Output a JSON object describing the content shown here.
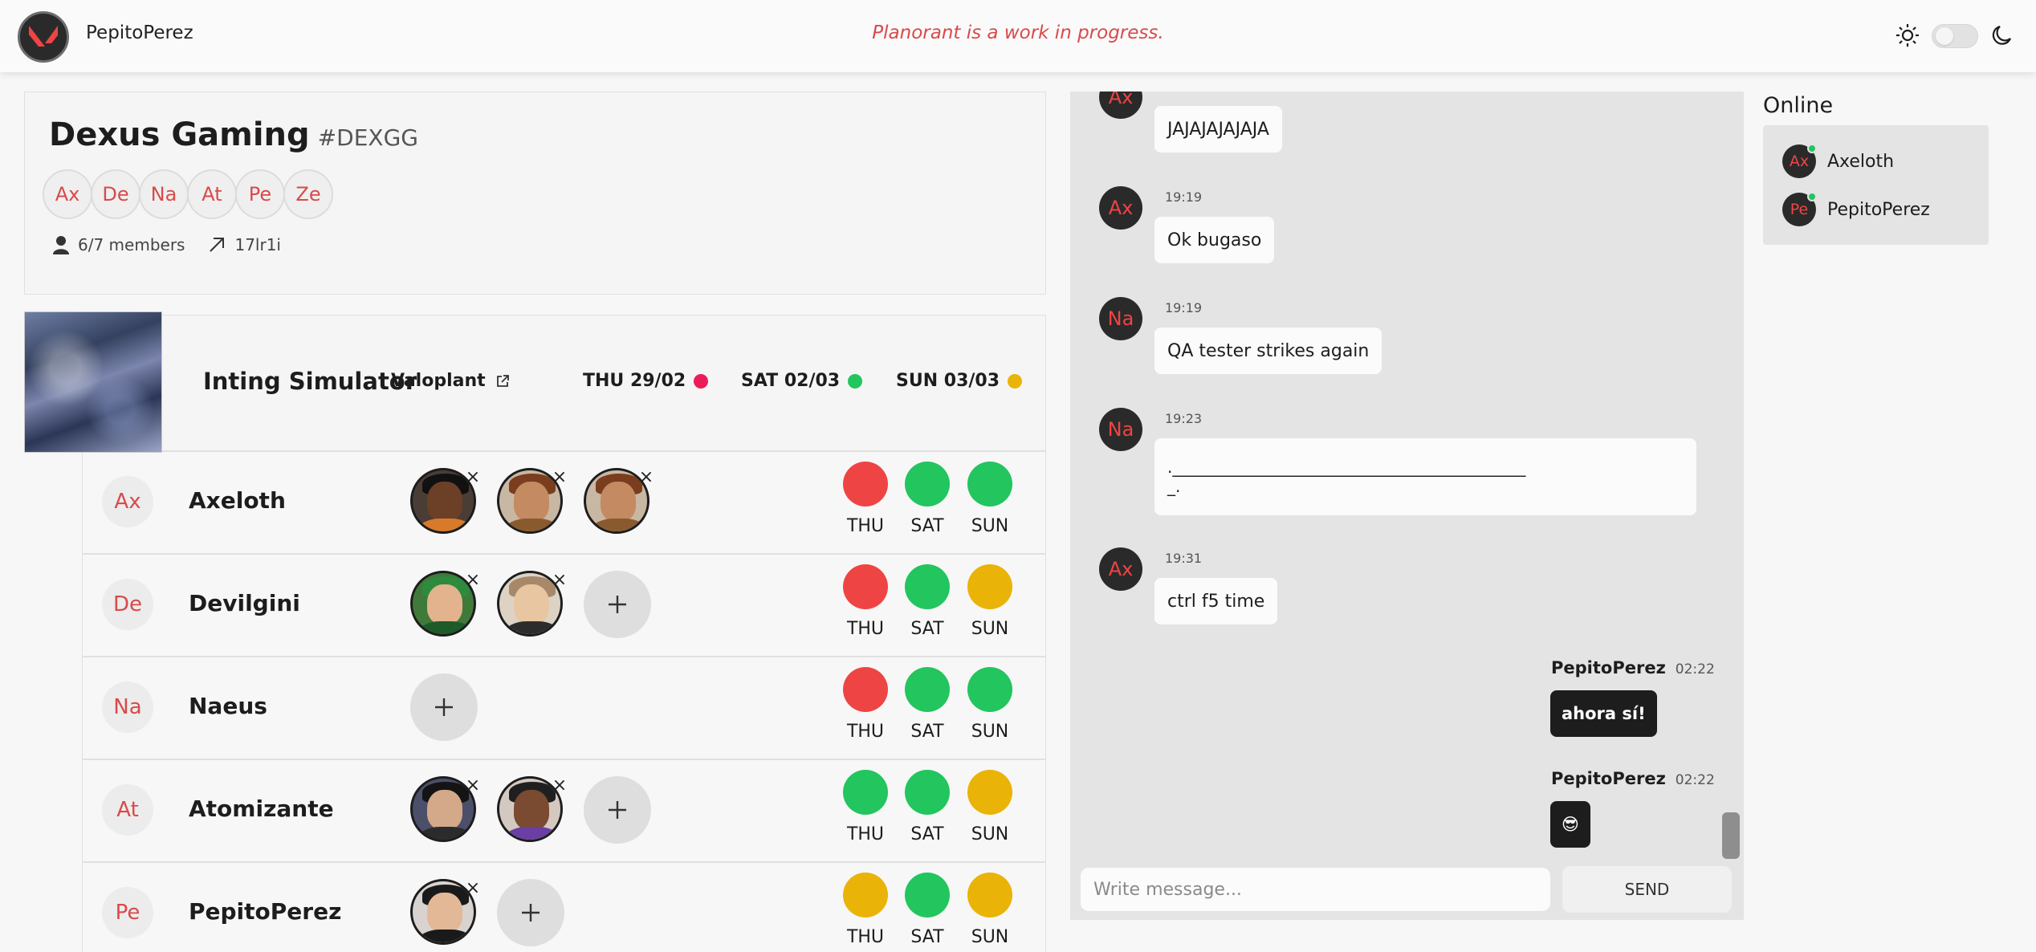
{
  "header": {
    "username": "PepitoPerez",
    "banner": "Planorant is a work in progress."
  },
  "team": {
    "name": "Dexus Gaming",
    "tag": "#DEXGG",
    "member_chips": [
      "Ax",
      "De",
      "Na",
      "At",
      "Pe",
      "Ze"
    ],
    "members": "6/7 members",
    "invite_code": "17lr1i"
  },
  "match": {
    "title": "Inting Simulator",
    "link_label": "Valoplant",
    "days": [
      {
        "label": "THU 29/02",
        "color": "#ec1c5a"
      },
      {
        "label": "SAT 02/03",
        "color": "#22c55e"
      },
      {
        "label": "SUN 03/03",
        "color": "#eab308"
      }
    ]
  },
  "players": [
    {
      "initials": "Ax",
      "name": "Axeloth",
      "agents": 3,
      "has_add": false,
      "availability": [
        "red",
        "green",
        "green"
      ]
    },
    {
      "initials": "De",
      "name": "Devilgini",
      "agents": 2,
      "has_add": true,
      "availability": [
        "red",
        "green",
        "yellow"
      ]
    },
    {
      "initials": "Na",
      "name": "Naeus",
      "agents": 0,
      "has_add": true,
      "availability": [
        "red",
        "green",
        "green"
      ]
    },
    {
      "initials": "At",
      "name": "Atomizante",
      "agents": 2,
      "has_add": true,
      "availability": [
        "green",
        "green",
        "yellow"
      ]
    },
    {
      "initials": "Pe",
      "name": "PepitoPerez",
      "agents": 1,
      "has_add": true,
      "availability": [
        "yellow",
        "green",
        "yellow"
      ]
    }
  ],
  "availability_labels": [
    "THU",
    "SAT",
    "SUN"
  ],
  "chat": {
    "messages": [
      {
        "initials": "Ax",
        "time": "",
        "text": "JAJAJAJAJAJA"
      },
      {
        "initials": "Ax",
        "time": "19:19",
        "text": "Ok bugaso"
      },
      {
        "initials": "Na",
        "time": "19:19",
        "text": "QA tester strikes again"
      },
      {
        "initials": "Na",
        "time": "19:23",
        "text": ".____________________________________________",
        "text2": "_."
      },
      {
        "initials": "Ax",
        "time": "19:31",
        "text": "ctrl f5 time"
      }
    ],
    "own_messages": [
      {
        "author": "PepitoPerez",
        "time": "02:22",
        "text": "ahora sí!"
      },
      {
        "author": "PepitoPerez",
        "time": "02:22",
        "text": "😎"
      }
    ],
    "input_placeholder": "Write message...",
    "send_label": "SEND"
  },
  "online": {
    "title": "Online",
    "users": [
      {
        "initials": "Ax",
        "name": "Axeloth"
      },
      {
        "initials": "Pe",
        "name": "PepitoPerez"
      }
    ]
  }
}
